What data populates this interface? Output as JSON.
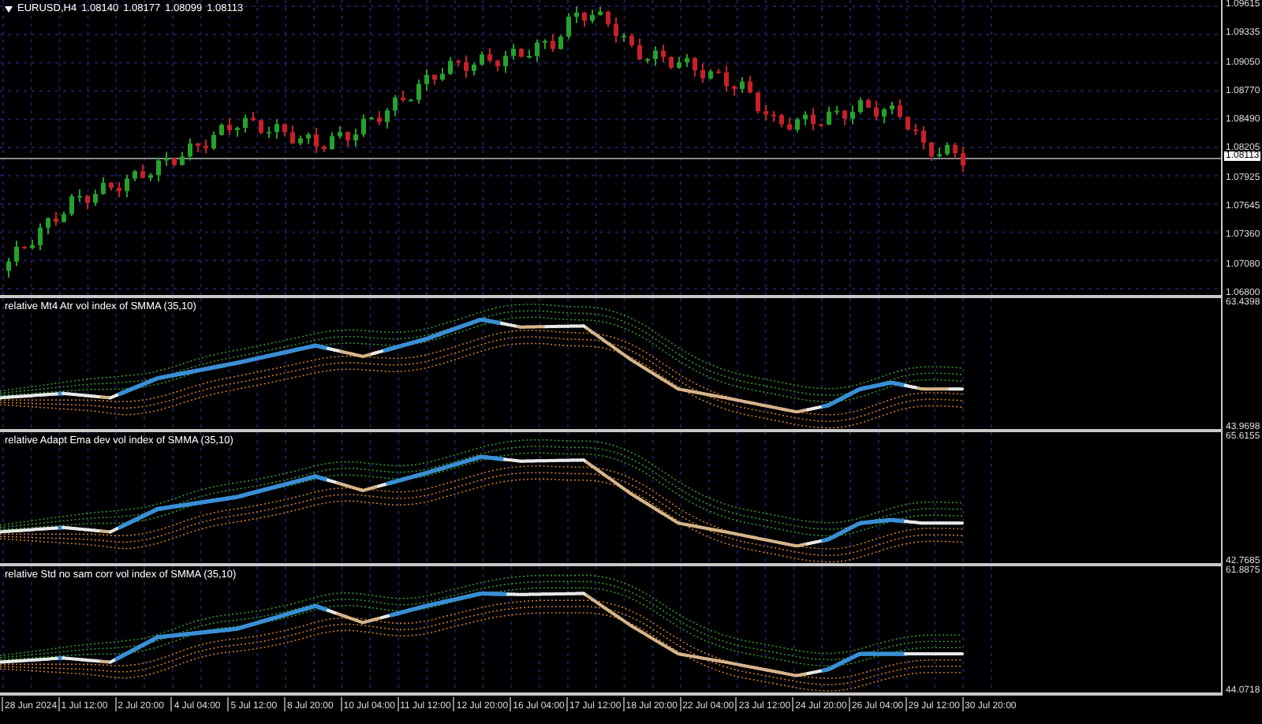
{
  "header": {
    "symbol": "EURUSD,H4",
    "prices": [
      "1.08140",
      "1.08177",
      "1.08099",
      "1.08113"
    ]
  },
  "price_axis": {
    "ticks": [
      "1.09615",
      "1.09335",
      "1.09050",
      "1.08770",
      "1.08490",
      "1.08205",
      "1.07925",
      "1.07645",
      "1.07360",
      "1.07080",
      "1.06800"
    ],
    "current_price": "1.08113"
  },
  "indicators": [
    {
      "label": "relative Mt4 Atr vol index of SMMA (35,10)",
      "max": "63.4398",
      "min": "43.9698"
    },
    {
      "label": "relative Adapt Ema dev vol index of SMMA (35,10)",
      "max": "65.6155",
      "min": "42.7685"
    },
    {
      "label": "relative Std no sam corr vol index of SMMA (35,10)",
      "max": "61.8875",
      "min": "44.0718"
    }
  ],
  "time_axis": [
    "28 Jun 2024",
    "1 Jul 12:00",
    "2 Jul 20:00",
    "4 Jul 04:00",
    "5 Jul 12:00",
    "8 Jul 20:00",
    "10 Jul 04:00",
    "11 Jul 12:00",
    "12 Jul 20:00",
    "16 Jul 04:00",
    "17 Jul 12:00",
    "18 Jul 20:00",
    "22 Jul 04:00",
    "23 Jul 12:00",
    "24 Jul 20:00",
    "26 Jul 04:00",
    "29 Jul 12:00",
    "30 Jul 20:00"
  ]
}
